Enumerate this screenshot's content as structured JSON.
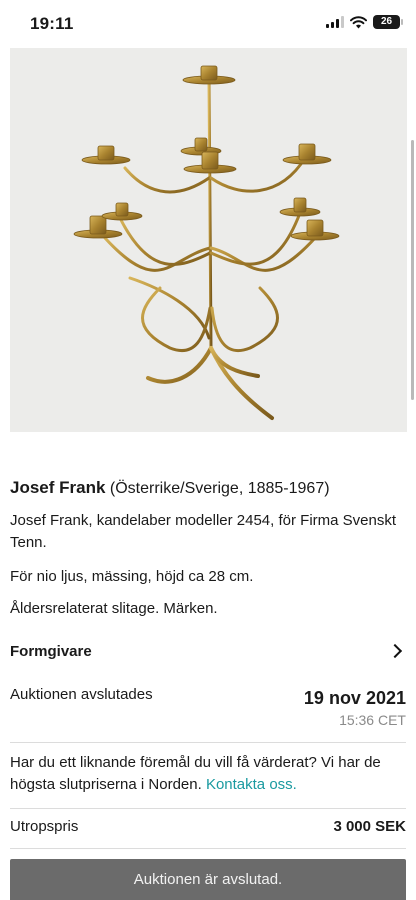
{
  "status_bar": {
    "time": "19:11",
    "battery": "26"
  },
  "listing": {
    "designer_name": "Josef Frank",
    "designer_info": "(Österrike/Sverige, 1885-1967)",
    "description": [
      "Josef Frank, kandelaber modeller 2454, för Firma Svenskt Tenn.",
      "För nio ljus, mässing, höjd ca 28 cm.",
      "Åldersrelaterat slitage. Märken."
    ]
  },
  "formgivare": {
    "label": "Formgivare"
  },
  "auction": {
    "ended_label": "Auktionen avslutades",
    "end_date": "19 nov 2021",
    "end_time": "15:36 CET"
  },
  "valuation": {
    "text": "Har du ett liknande föremål du vill få värderat? Vi har de högsta slutpriserna i Norden. ",
    "link": "Kontakta oss."
  },
  "reserve": {
    "label": "Utropspris",
    "value": "3 000 SEK"
  },
  "footer": {
    "closed_label": "Auktionen är avslutad."
  },
  "colors": {
    "link": "#1a9aa0",
    "button": "#6b6b6b"
  }
}
